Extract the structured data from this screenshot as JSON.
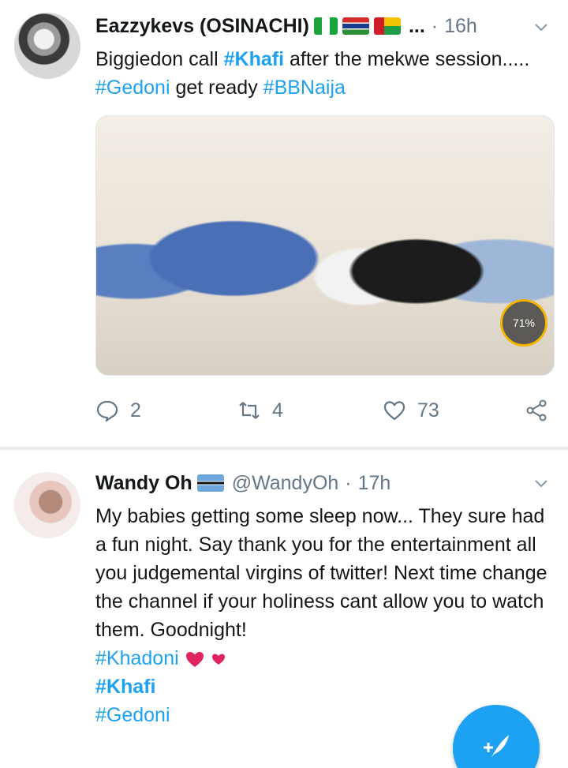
{
  "tweets": [
    {
      "author": "Eazzykevs (OSINACHI)",
      "flags": [
        "flag-nigeria",
        "flag-gambia",
        "flag-guinea-bissau"
      ],
      "truncated": "...",
      "separator": "·",
      "time": "16h",
      "text": [
        {
          "t": "Biggiedon call ",
          "style": "plain"
        },
        {
          "t": "#Khafi",
          "style": "hashtag-bold"
        },
        {
          "t": " after the mekwe session..... ",
          "style": "plain"
        },
        {
          "t": "#Gedoni",
          "style": "hashtag"
        },
        {
          "t": " get ready ",
          "style": "plain"
        },
        {
          "t": "#BBNaija",
          "style": "hashtag"
        }
      ],
      "media_badge": "71%",
      "actions": {
        "replies": "2",
        "retweets": "4",
        "likes": "73"
      }
    },
    {
      "author": "Wandy Oh",
      "flags": [
        "flag-botswana"
      ],
      "handle": "@WandyOh",
      "separator": "·",
      "time": "17h",
      "body": "My babies getting some sleep now... They sure had a fun night. Say thank you for the entertainment all you judgemental virgins of twitter! Next time change the channel if your holiness cant allow you to watch them. Goodnight!",
      "hashtags": [
        "#Khadoni",
        "#Khafi",
        "#Gedoni"
      ]
    }
  ],
  "icons": {
    "menu": "chevron-down-icon",
    "reply": "reply-icon",
    "retweet": "retweet-icon",
    "like": "heart-icon",
    "share": "share-icon",
    "compose": "compose-tweet-icon",
    "emoji": "two-hearts-emoji"
  },
  "colors": {
    "link": "#1da1f2",
    "muted": "#657786",
    "fab": "#1da1f2",
    "separator": "#e6ecf0"
  }
}
